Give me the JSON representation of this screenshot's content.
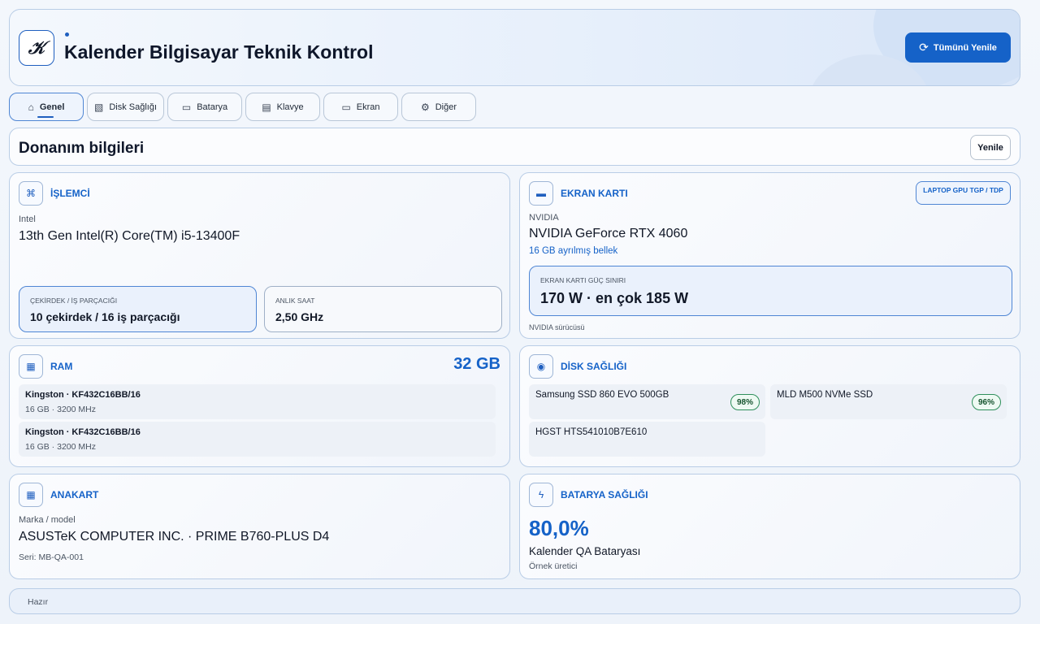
{
  "app": {
    "logo_glyph": "𝒦",
    "title": "Kalender Bilgisayar Teknik Kontrol",
    "refresh_all": "Tümünü Yenile",
    "accent": "#1562c8"
  },
  "tabs": [
    {
      "label": "Genel",
      "icon": "home-icon",
      "active": true
    },
    {
      "label": "Disk Sağlığı",
      "icon": "disk-chart-icon"
    },
    {
      "label": "Batarya",
      "icon": "battery-icon"
    },
    {
      "label": "Klavye",
      "icon": "keyboard-icon"
    },
    {
      "label": "Ekran",
      "icon": "monitor-icon"
    },
    {
      "label": "Diğer",
      "icon": "gear-icon"
    }
  ],
  "section": {
    "title": "Donanım bilgileri",
    "refresh": "Yenile"
  },
  "cpu": {
    "title": "İŞLEMCİ",
    "icon": "cpu-icon",
    "vendor": "Intel",
    "model": "13th Gen Intel(R) Core(TM) i5-13400F",
    "cores_label": "ÇEKİRDEK / İŞ PARÇACIĞI",
    "cores_value": "10 çekirdek / 16 iş parçacığı",
    "clock_label": "ANLIK SAAT",
    "clock_value": "2,50 GHz"
  },
  "gpu": {
    "title": "EKRAN KARTI",
    "icon": "gpu-icon",
    "badge": "LAPTOP GPU TGP / TDP",
    "vendor": "NVIDIA",
    "model": "NVIDIA GeForce RTX 4060",
    "memory": "16 GB ayrılmış bellek",
    "power_label": "EKRAN KARTI GÜÇ SINIRI",
    "power_value": "170 W · en çok 185 W",
    "driver": "NVIDIA sürücüsü"
  },
  "ram": {
    "title": "RAM",
    "icon": "ram-icon",
    "total": "32 GB",
    "modules": [
      {
        "name": "Kingston · KF432C16BB/16",
        "spec": "16 GB · 3200 MHz"
      },
      {
        "name": "Kingston · KF432C16BB/16",
        "spec": "16 GB · 3200 MHz"
      }
    ]
  },
  "disk": {
    "title": "DİSK SAĞLIĞI",
    "icon": "disk-icon",
    "drives": [
      {
        "name": "Samsung SSD 860 EVO 500GB",
        "health": "98%"
      },
      {
        "name": "MLD M500 NVMe SSD",
        "health": "96%"
      },
      {
        "name": "HGST HTS541010B7E610",
        "health": ""
      }
    ]
  },
  "board": {
    "title": "ANAKART",
    "icon": "motherboard-icon",
    "label": "Marka / model",
    "model": "ASUSTeK COMPUTER INC. · PRIME B760-PLUS D4",
    "serial": "Seri: MB-QA-001"
  },
  "battery": {
    "title": "BATARYA SAĞLIĞI",
    "icon": "battery-health-icon",
    "percent": "80,0%",
    "name": "Kalender QA Bataryası",
    "maker": "Örnek üretici"
  },
  "status": {
    "text": "Hazır"
  }
}
